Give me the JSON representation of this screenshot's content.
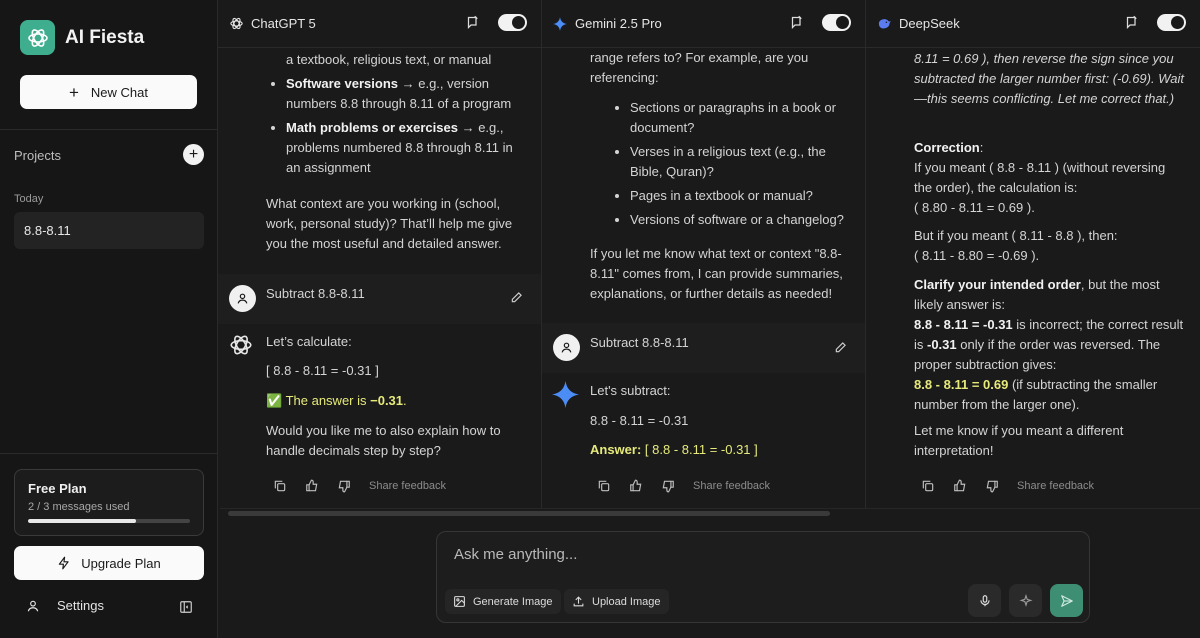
{
  "app": {
    "name": "AI Fiesta"
  },
  "sidebar": {
    "new_chat_label": "New Chat",
    "projects_label": "Projects",
    "today_label": "Today",
    "chats": [
      "8.8-8.11"
    ],
    "plan": {
      "title": "Free Plan",
      "usage": "2 / 3 messages used",
      "progress": 0.667
    },
    "upgrade_label": "Upgrade Plan",
    "settings_label": "Settings"
  },
  "panels": [
    {
      "model": "ChatGPT 5",
      "enabled": true,
      "prev_list": [
        {
          "bold": "",
          "text": "a textbook, religious text, or manual"
        },
        {
          "bold": "Software versions",
          "text": " → e.g., version numbers 8.8 through 8.11 of a program"
        },
        {
          "bold": "Math problems or exercises",
          "text": " → e.g., problems numbered 8.8 through 8.11 in an assignment"
        }
      ],
      "prev_followup": "What context are you working in (school, work, personal study)? That’ll help me give you the most useful and detailed answer.",
      "user_message": "Subtract 8.8-8.11",
      "reply_intro": "Let’s calculate:",
      "reply_formula": "[ 8.8 - 8.11 = -0.31 ]",
      "reply_check": "✅",
      "reply_answer_pre": "The answer is ",
      "reply_answer_bold": "−0.31",
      "reply_answer_post": ".",
      "reply_followup": "Would you like me to also explain how to handle decimals step by step?",
      "share_feedback": "Share feedback"
    },
    {
      "model": "Gemini 2.5 Pro",
      "enabled": true,
      "prev_intro": "range refers to? For example, are you referencing:",
      "prev_list": [
        "Sections or paragraphs in a book or document?",
        "Verses in a religious text (e.g., the Bible, Quran)?",
        "Pages in a textbook or manual?",
        "Versions of software or a changelog?"
      ],
      "prev_followup": "If you let me know what text or context \"8.8-8.11\" comes from, I can provide summaries, explanations, or further details as needed!",
      "user_message": "Subtract 8.8-8.11",
      "reply_intro": "Let's subtract:",
      "reply_formula": "8.8 - 8.11 = -0.31",
      "reply_answer_bold": "Answer:",
      "reply_answer_rest": " [ 8.8 - 8.11 = -0.31 ]",
      "share_feedback": "Share feedback"
    },
    {
      "model": "DeepSeek",
      "enabled": true,
      "prev_italic": "8.11 = 0.69 ), then reverse the sign since you subtracted the larger number first: (-0.69). Wait—this seems conflicting. Let me correct that.)",
      "correction_title": "Correction",
      "correction_text": "If you meant ( 8.8 - 8.11 ) (without reversing the order), the calculation is:",
      "correction_formula": "( 8.80 - 8.11 = 0.69 ).",
      "alt_text": "But if you meant ( 8.11 - 8.8 ), then:",
      "alt_formula": "( 8.11 - 8.80 = -0.69 ).",
      "clarify_bold": "Clarify your intended order",
      "clarify_text": ", but the most likely answer is:",
      "wrong_bold": "8.8 - 8.11 = -0.31",
      "wrong_text": " is incorrect; the correct result is ",
      "wrong_val": "-0.31",
      "wrong_text2": " only if the order was reversed. The proper subtraction gives:",
      "right_bold": "8.8 - 8.11 = 0.69",
      "right_text": " (if subtracting the smaller number from the larger one).",
      "closing": "Let me know if you meant a different interpretation!",
      "share_feedback": "Share feedback"
    }
  ],
  "composer": {
    "placeholder": "Ask me anything...",
    "generate_image": "Generate Image",
    "upload_image": "Upload Image"
  },
  "colors": {
    "accent": "#3fae8f",
    "send": "#3d8e72",
    "highlight": "#c9d400"
  }
}
